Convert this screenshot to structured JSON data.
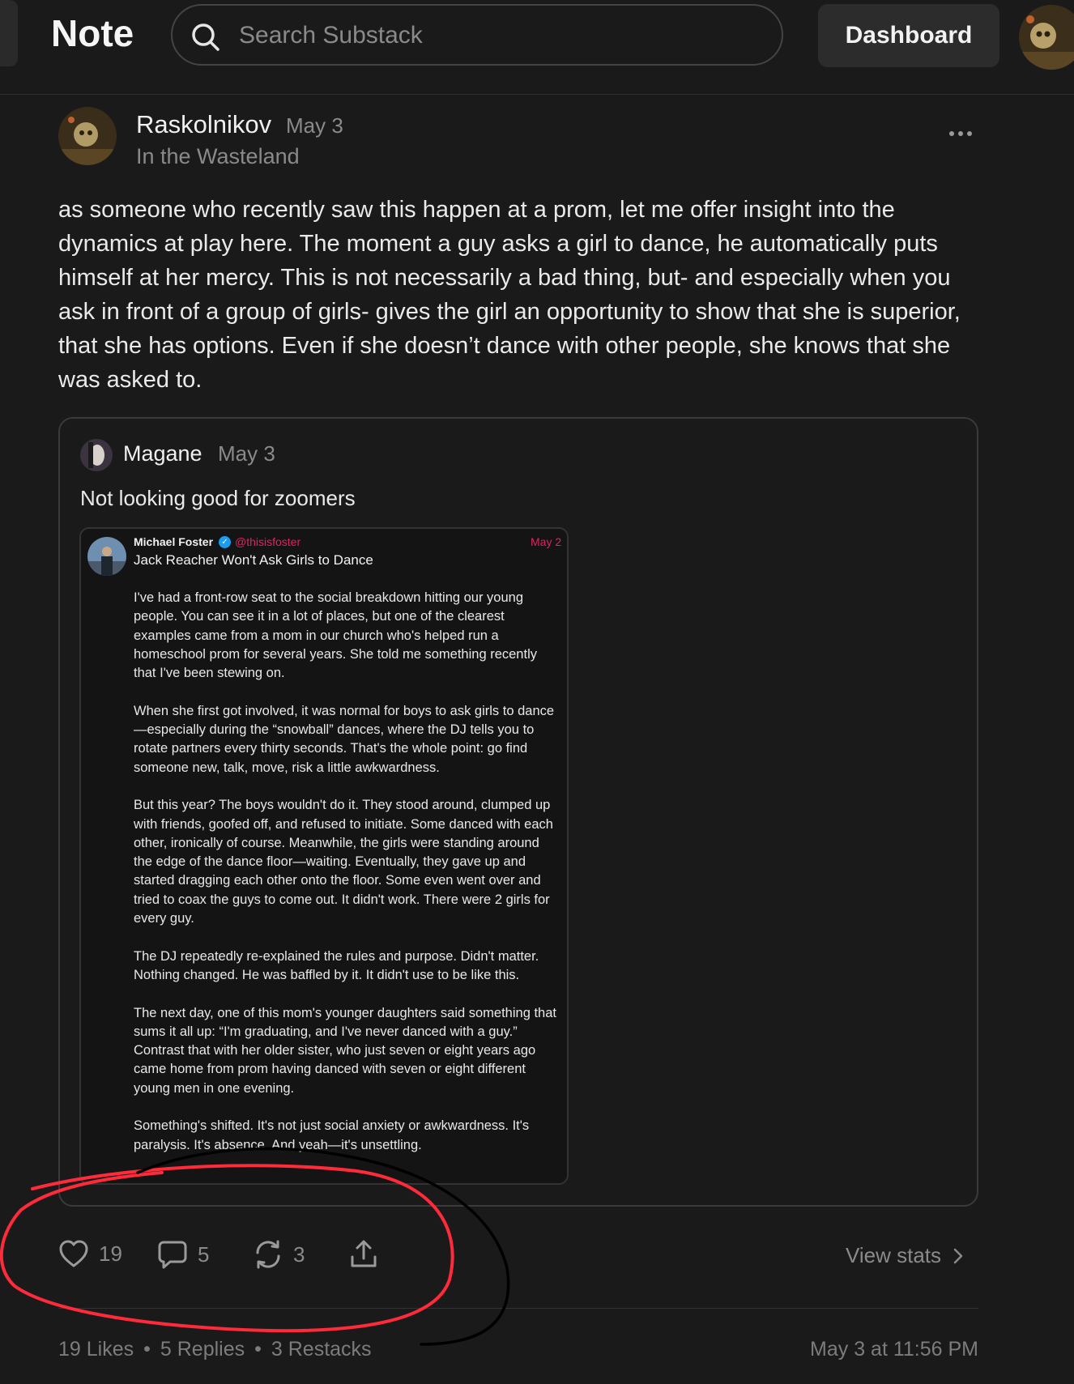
{
  "header": {
    "title": "Note",
    "search_placeholder": "Search Substack",
    "dashboard_label": "Dashboard"
  },
  "post": {
    "author": "Raskolnikov",
    "date": "May 3",
    "publication": "In the Wasteland",
    "body": "as someone who recently saw this happen at a prom, let me offer insight into the dynamics at play here. The moment a guy asks a girl to dance, he automatically puts himself at her mercy. This is not necessarily a bad thing, but- and especially when you ask in front of a group of girls- gives the girl an opportunity to show that she is superior, that she has options. Even if she doesn’t dance with other people, she knows that she was asked to."
  },
  "quoted": {
    "author": "Magane",
    "date": "May 3",
    "text": "Not looking good for zoomers",
    "screenshot": {
      "name": "Michael Foster",
      "handle": "@thisisfoster",
      "date": "May 2",
      "title": "Jack Reacher Won't Ask Girls to Dance",
      "paragraphs": [
        "I've had a front-row seat to the social breakdown hitting our young people. You can see it in a lot of places, but one of the clearest examples came from a mom in our church who's helped run a homeschool prom for several years. She told me something recently that I've been stewing on.",
        "When she first got involved, it was normal for boys to ask girls to dance—especially during the “snowball” dances, where the DJ tells you to rotate partners every thirty seconds. That's the whole point: go find someone new, talk, move, risk a little awkwardness.",
        "But this year? The boys wouldn't do it. They stood around, clumped up with friends, goofed off, and refused to initiate. Some danced with each other, ironically of course. Meanwhile, the girls were standing around the edge of the dance floor—waiting. Eventually, they gave up and started dragging each other onto the floor. Some even went over and tried to coax the guys to come out. It didn't work. There were 2 girls for every guy.",
        "The DJ repeatedly re-explained the rules and purpose. Didn't matter. Nothing changed. He was baffled by it. It didn't use to be like this.",
        "The next day, one of this mom's younger daughters said something that sums it all up: “I'm graduating, and I've never danced with a guy.” Contrast that with her older sister, who just seven or eight years ago came home from prom having danced with seven or eight different young men in one evening.",
        "Something's shifted. It's not just social anxiety or awkwardness. It's paralysis. It's absence. And yeah—it's unsettling."
      ]
    }
  },
  "actions": {
    "likes": "19",
    "comments": "5",
    "restacks": "3",
    "view_stats": "View stats"
  },
  "footer": {
    "likes_text": "19 Likes",
    "replies_text": "5 Replies",
    "restacks_text": "3 Restacks",
    "separator": "•",
    "timestamp": "May 3 at 11:56 PM"
  },
  "colors": {
    "background": "#1a1a1a",
    "accent_red": "#e0245e",
    "annotation_red": "#ff2a3a",
    "annotation_black": "#000000"
  },
  "icons": [
    "search-icon",
    "more-icon",
    "heart-icon",
    "comment-icon",
    "restack-icon",
    "share-icon",
    "chevron-right-icon",
    "verified-icon"
  ]
}
